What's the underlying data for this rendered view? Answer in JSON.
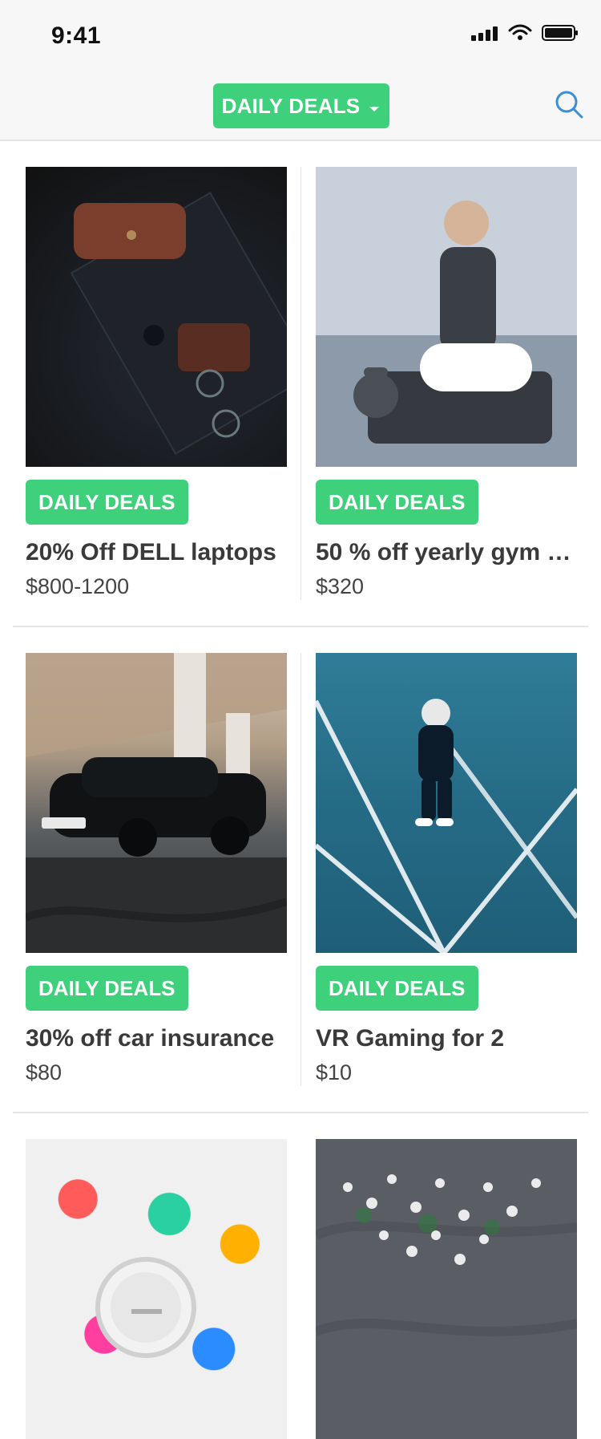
{
  "status_bar": {
    "time": "9:41"
  },
  "nav": {
    "category_label": "DAILY DEALS",
    "dropdown_icon": "caret-down-icon",
    "search_icon": "search-icon"
  },
  "colors": {
    "accent_green": "#3FD07B",
    "search_blue": "#3A8FD6"
  },
  "deals": [
    {
      "badge": "DAILY DEALS",
      "title": "20% Off DELL laptops",
      "price": "$800-1200"
    },
    {
      "badge": "DAILY DEALS",
      "title": "50 % off yearly gym …",
      "price": "$320"
    },
    {
      "badge": "DAILY DEALS",
      "title": "30% off car insurance",
      "price": "$80"
    },
    {
      "badge": "DAILY DEALS",
      "title": "VR Gaming for 2",
      "price": "$10"
    }
  ]
}
